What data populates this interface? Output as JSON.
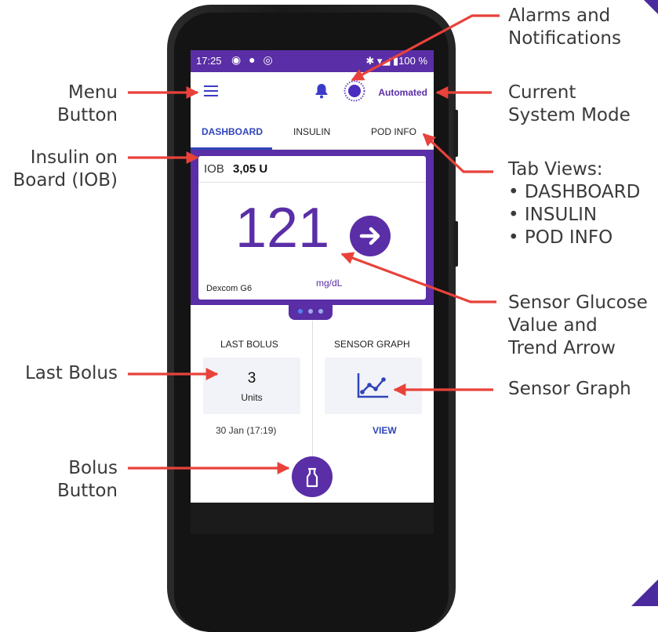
{
  "annotations": {
    "alarms": [
      "Alarms and",
      "Notifications"
    ],
    "menu": [
      "Menu",
      "Button"
    ],
    "mode": [
      "Current",
      "System Mode"
    ],
    "iob": [
      "Insulin on",
      "Board (IOB)"
    ],
    "tab_views": {
      "title": "Tab Views:",
      "items": [
        "DASHBOARD",
        "INSULIN",
        "POD INFO"
      ]
    },
    "sensor_value": [
      "Sensor Glucose",
      "Value and",
      "Trend Arrow"
    ],
    "last_bolus": "Last Bolus",
    "sensor_graph": "Sensor Graph",
    "bolus_button": [
      "Bolus",
      "Button"
    ]
  },
  "phone": {
    "status": {
      "time": "17:25",
      "icons": "◉ ● ◎",
      "right": "✱ ▾◢ ▮100 %"
    },
    "mode_label": "Automated",
    "tabs": [
      "DASHBOARD",
      "INSULIN",
      "POD INFO"
    ],
    "iob": {
      "label": "IOB",
      "value": "3,05 U"
    },
    "glucose": {
      "value": "121",
      "unit": "mg/dL",
      "sensor": "Dexcom G6"
    },
    "last_bolus": {
      "title": "LAST BOLUS",
      "value": "3",
      "unit": "Units",
      "date": "30 Jan (17:19)"
    },
    "sensor_graph": {
      "title": "SENSOR GRAPH",
      "link": "VIEW"
    }
  },
  "colors": {
    "purple": "#5a2ea6",
    "arrow_red": "#e8423b",
    "blue": "#3045b8",
    "corner": "#4b2a9e"
  }
}
